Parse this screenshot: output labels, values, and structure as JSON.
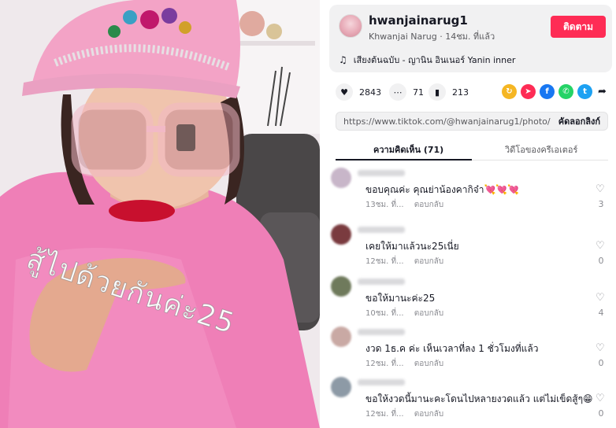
{
  "photo": {
    "caption": "สู้ไปด้วยกันค่ะ25"
  },
  "author": {
    "username": "hwanjainarug1",
    "display_name": "Khwanjai Narug",
    "time_ago": "14ชม. ที่แล้ว",
    "follow_label": "ติดตาม",
    "music": "เสียงต้นฉบับ - ญานิน อินเนอร์ Yanin inner"
  },
  "actions": {
    "likes": "2843",
    "comments": "71",
    "saves": "213"
  },
  "share_colors": {
    "repost": "#f5b623",
    "send": "#fe2c55",
    "facebook": "#1877f2",
    "whatsapp": "#25d366",
    "twitter": "#1da1f2"
  },
  "link": {
    "url": "https://www.tiktok.com/@hwanjainarug1/photo/744...",
    "copy_label": "คัดลอกลิงก์"
  },
  "tabs": {
    "comments": "ความคิดเห็น (71)",
    "creator_videos": "วิดีโอของครีเอเตอร์"
  },
  "comments": [
    {
      "text": "ขอบคุณค่ะ คุณย่าน้องคากิจ๋า💘💘💘",
      "time": "13ชม. ที่...",
      "reply": "ตอบกลับ",
      "likes": "3",
      "avatar_color": "#c8b6c9"
    },
    {
      "text": "เคยให้มาแล้วนะ25เนี่ย",
      "time": "12ชม. ที่...",
      "reply": "ตอบกลับ",
      "likes": "0",
      "avatar_color": "#7a3b3f"
    },
    {
      "text": "ขอให้มานะค่ะ25",
      "time": "10ชม. ที่...",
      "reply": "ตอบกลับ",
      "likes": "4",
      "avatar_color": "#6f7a5c"
    },
    {
      "text": "งวด 1ธ.ค ค่ะ เห็นเวลาที่ลง 1 ชั่วโมงที่แล้ว",
      "time": "12ชม. ที่...",
      "reply": "ตอบกลับ",
      "likes": "0",
      "avatar_color": "#c9a9a4"
    },
    {
      "text": "ขอให้งวดนี้มานะคะโดนไปหลายงวดแล้ว แต่ไม่เข็ดสู้ๆ😁",
      "time": "12ชม. ที่...",
      "reply": "ตอบกลับ",
      "likes": "0",
      "avatar_color": "#8d9aa6"
    }
  ]
}
